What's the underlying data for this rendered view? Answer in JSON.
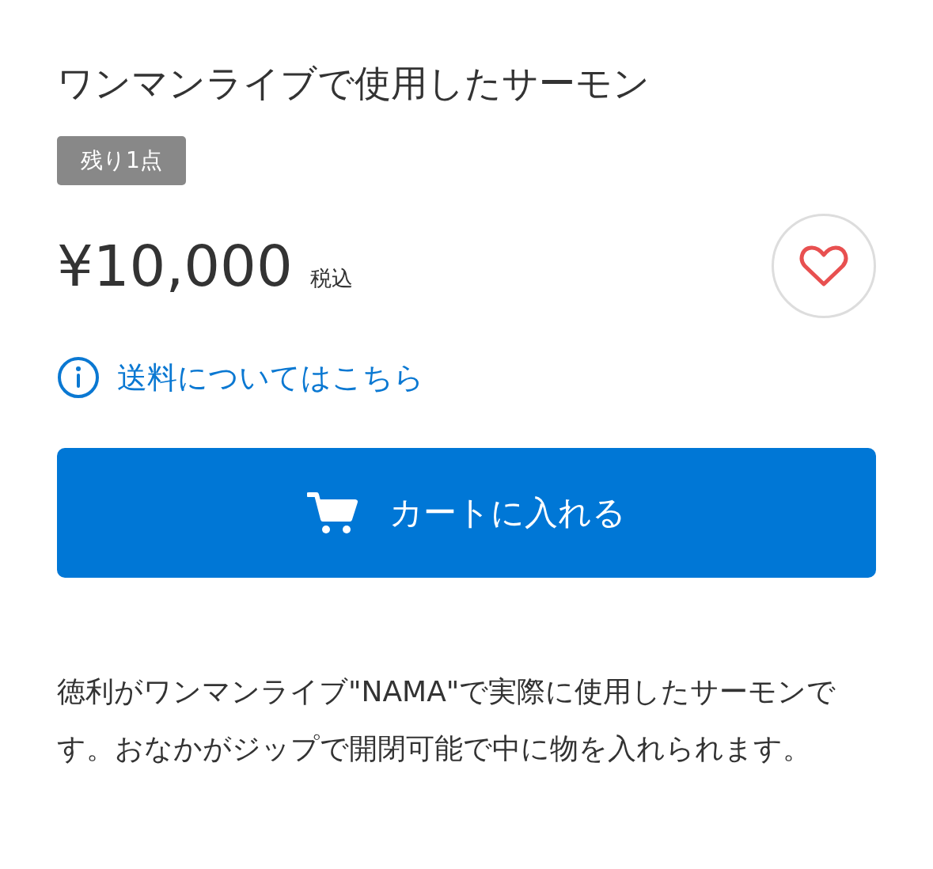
{
  "product": {
    "title": "ワンマンライブで使用したサーモン",
    "stock_badge": "残り1点",
    "price": "¥10,000",
    "tax_note": "税込",
    "favorited": false
  },
  "shipping_link": {
    "label": "送料についてはこちら"
  },
  "cart_button": {
    "label": "カートに入れる"
  },
  "description": "徳利がワンマンライブ\"NAMA\"で実際に使用したサーモンです。おなかがジップで開閉可能で中に物を入れられます。"
}
